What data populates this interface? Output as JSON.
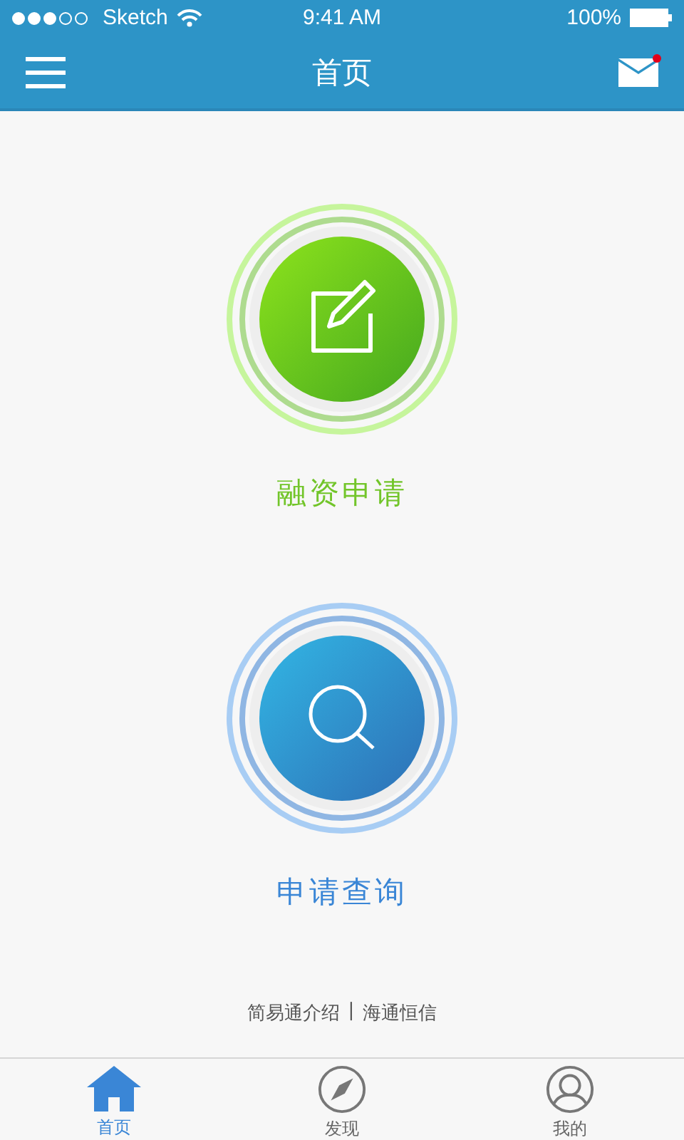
{
  "status_bar": {
    "carrier": "Sketch",
    "time": "9:41 AM",
    "battery": "100%"
  },
  "nav_bar": {
    "title": "首页",
    "unread": true
  },
  "actions": [
    {
      "kind": "apply",
      "label": "融资申请"
    },
    {
      "kind": "query",
      "label": "申请查询"
    }
  ],
  "footer": {
    "links": [
      "简易通介绍",
      "海通恒信"
    ],
    "separator": "|"
  },
  "tabs": [
    {
      "kind": "home",
      "label": "首页",
      "selected": true
    },
    {
      "kind": "discover",
      "label": "发现",
      "selected": false
    },
    {
      "kind": "profile",
      "label": "我的",
      "selected": false
    }
  ]
}
